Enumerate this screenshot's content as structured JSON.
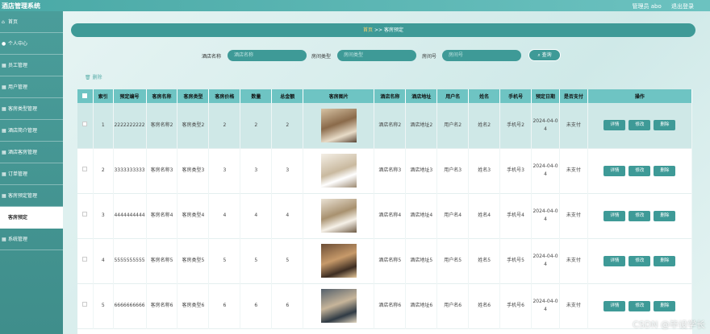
{
  "app": {
    "title": "酒店管理系统",
    "user": "管理员 abo",
    "logout": "退出登录"
  },
  "sidebar": {
    "items": [
      {
        "icon": "home-icon",
        "glyph": "⌂",
        "label": "首页"
      },
      {
        "icon": "user-icon",
        "glyph": "●",
        "label": "个人中心"
      },
      {
        "icon": "grid-icon",
        "glyph": "▦",
        "label": "员工管理"
      },
      {
        "icon": "grid-icon",
        "glyph": "▦",
        "label": "用户管理"
      },
      {
        "icon": "grid-icon",
        "glyph": "▦",
        "label": "客房类型管理"
      },
      {
        "icon": "grid-icon",
        "glyph": "▦",
        "label": "酒店简介管理"
      },
      {
        "icon": "grid-icon",
        "glyph": "▦",
        "label": "酒店客房管理"
      },
      {
        "icon": "grid-icon",
        "glyph": "▦",
        "label": "订单管理"
      },
      {
        "icon": "grid-icon",
        "glyph": "▦",
        "label": "客房预定管理"
      },
      {
        "icon": "",
        "glyph": "",
        "label": "客房预定"
      },
      {
        "icon": "grid-icon",
        "glyph": "▦",
        "label": "系统管理"
      }
    ]
  },
  "breadcrumb": {
    "home": "首页",
    "sep": ">>",
    "current": "客房预定"
  },
  "search": {
    "hotel_label": "酒店名称",
    "hotel_placeholder": "酒店名称",
    "type_label": "房间类型",
    "type_placeholder": "房间类型",
    "room_label": "房间号",
    "room_placeholder": "房间号",
    "query": "查询"
  },
  "toolbar": {
    "delete": "删除"
  },
  "table": {
    "headers": [
      "索引",
      "预定编号",
      "客房名称",
      "客房类型",
      "客房价格",
      "数量",
      "总金额",
      "客房图片",
      "酒店名称",
      "酒店地址",
      "用户名",
      "姓名",
      "手机号",
      "预定日期",
      "是否支付",
      "操作"
    ],
    "buttons": {
      "detail": "详情",
      "edit": "修改",
      "delete": "删除"
    },
    "rows": [
      {
        "idx": "1",
        "no": "2222222222",
        "room": "客房名称2",
        "type": "客房类型2",
        "price": "2",
        "qty": "2",
        "total": "2",
        "img": "bedroom-photo",
        "hotel": "酒店名称2",
        "addr": "酒店地址2",
        "username": "用户名2",
        "name": "姓名2",
        "phone": "手机号2",
        "date": "2024-04-04",
        "paid": "未支付"
      },
      {
        "idx": "2",
        "no": "3333333333",
        "room": "客房名称3",
        "type": "客房类型3",
        "price": "3",
        "qty": "3",
        "total": "3",
        "img": "bedroom-photo",
        "hotel": "酒店名称3",
        "addr": "酒店地址3",
        "username": "用户名3",
        "name": "姓名3",
        "phone": "手机号3",
        "date": "2024-04-04",
        "paid": "未支付"
      },
      {
        "idx": "3",
        "no": "4444444444",
        "room": "客房名称4",
        "type": "客房类型4",
        "price": "4",
        "qty": "4",
        "total": "4",
        "img": "bedroom-photo",
        "hotel": "酒店名称4",
        "addr": "酒店地址4",
        "username": "用户名4",
        "name": "姓名4",
        "phone": "手机号4",
        "date": "2024-04-04",
        "paid": "未支付"
      },
      {
        "idx": "4",
        "no": "5555555555",
        "room": "客房名称5",
        "type": "客房类型5",
        "price": "5",
        "qty": "5",
        "total": "5",
        "img": "bedroom-photo",
        "hotel": "酒店名称5",
        "addr": "酒店地址5",
        "username": "用户名5",
        "name": "姓名5",
        "phone": "手机号5",
        "date": "2024-04-04",
        "paid": "未支付"
      },
      {
        "idx": "5",
        "no": "6666666666",
        "room": "客房名称6",
        "type": "客房类型6",
        "price": "6",
        "qty": "6",
        "total": "6",
        "img": "bedroom-photo",
        "hotel": "酒店名称6",
        "addr": "酒店地址6",
        "username": "用户名6",
        "name": "姓名6",
        "phone": "手机号6",
        "date": "2024-04-04",
        "paid": "未支付"
      }
    ]
  },
  "watermark": "CSDN @毕设学长"
}
